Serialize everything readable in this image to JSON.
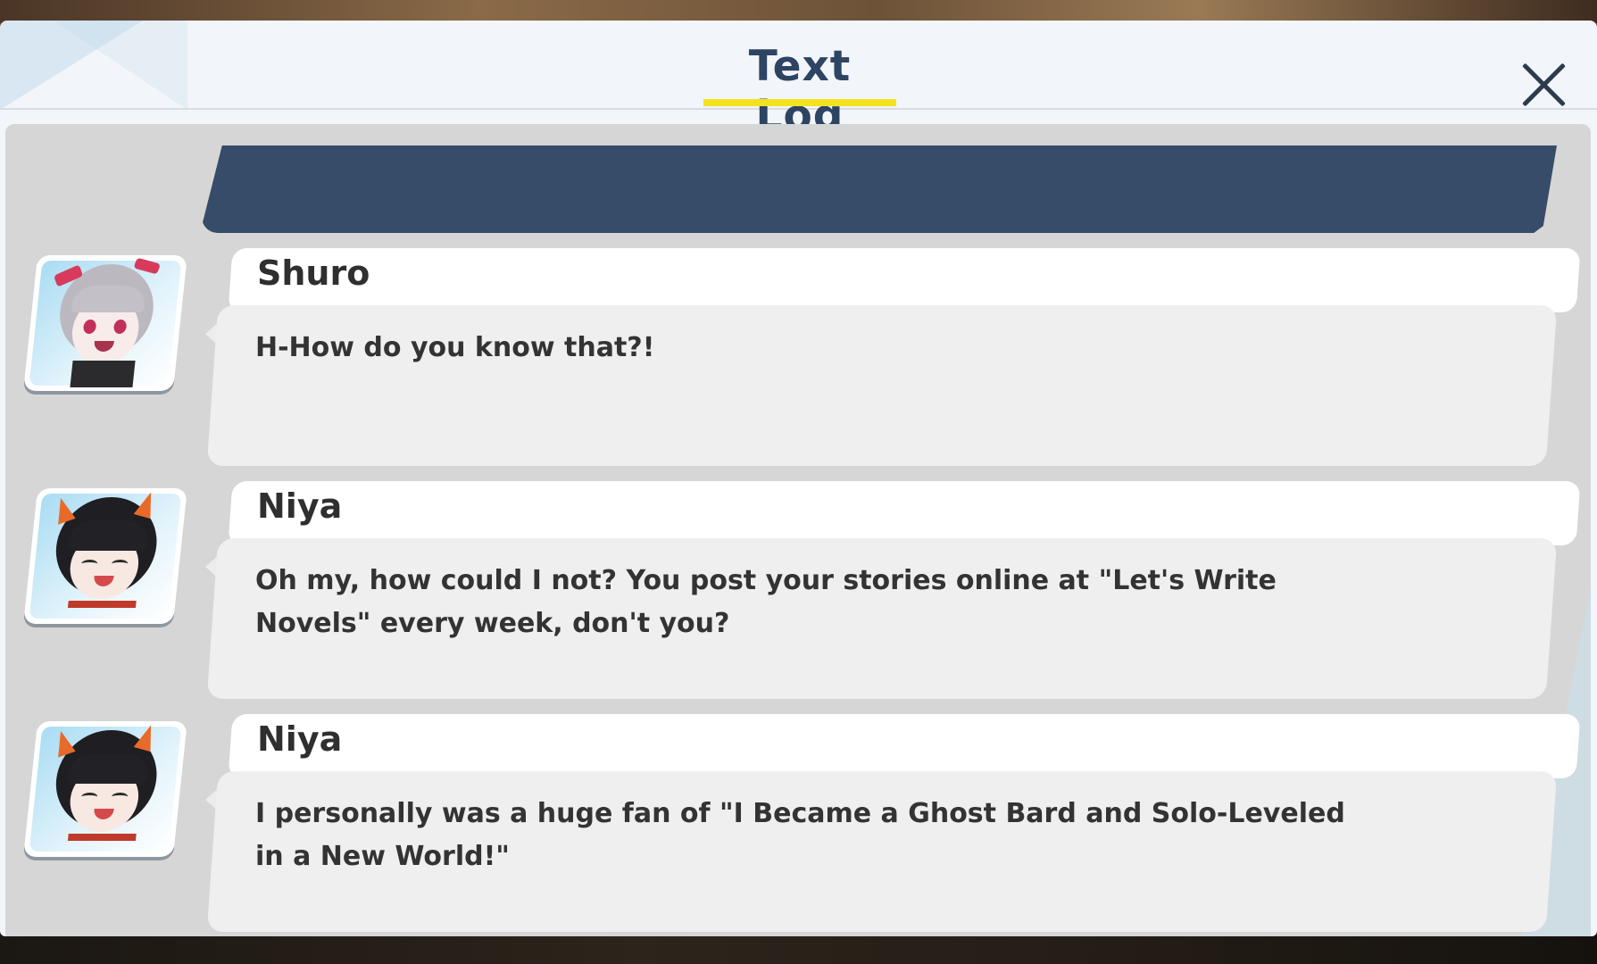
{
  "header": {
    "title": "Text Log",
    "close_icon": "close-icon"
  },
  "log": {
    "entries": [
      {
        "speaker": "Shuro",
        "text": "H-How do you know that?!",
        "avatar": "shuro-avatar"
      },
      {
        "speaker": "Niya",
        "text": "Oh my, how could I not? You post your stories online at \"Let's Write Novels\" every week, don't you?",
        "avatar": "niya-avatar"
      },
      {
        "speaker": "Niya",
        "text": "I personally was a huge fan of \"I Became a Ghost Bard and Solo-Leveled in a New World!\"",
        "avatar": "niya-avatar"
      }
    ]
  },
  "colors": {
    "title": "#2d4462",
    "title_underline": "#f3e21e",
    "banner": "#374c68",
    "log_background": "#d6d6d6",
    "name_bar": "#ffffff",
    "body_box": "#efefef"
  }
}
